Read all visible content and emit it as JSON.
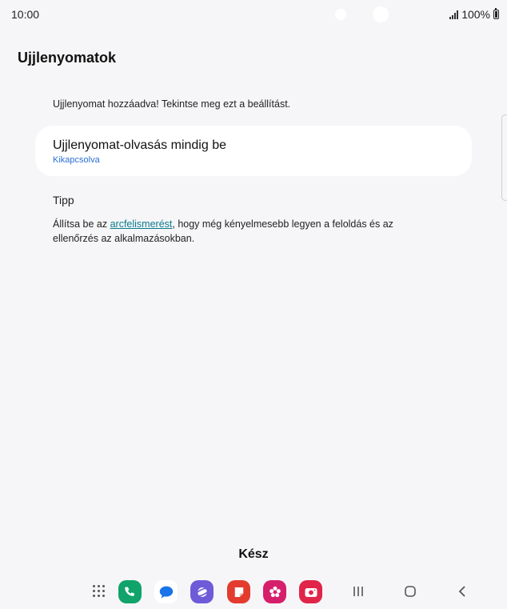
{
  "status_bar": {
    "time": "10:00",
    "battery": "100%"
  },
  "page": {
    "title": "Ujjlenyomatok",
    "added_message": "Ujjlenyomat hozzáadva! Tekintse meg ezt a beállítást."
  },
  "setting_card": {
    "title": "Ujjlenyomat-olvasás mindig be",
    "subtitle": "Kikapcsolva"
  },
  "tip": {
    "heading": "Tipp",
    "text_before": "Állítsa be az ",
    "link": "arcfelismerést",
    "text_after": ", hogy még kényelmesebb legyen a feloldás és az ellenőrzés az alkalmazásokban."
  },
  "done_label": "Kész",
  "colors": {
    "background": "#f6f6f8",
    "link": "#0b7a8c",
    "subtitle": "#2a6fd6"
  },
  "dock": {
    "icons": [
      "apps-grid-icon",
      "phone-icon",
      "messages-icon",
      "internet-icon",
      "notes-icon",
      "gallery-icon",
      "camera-icon"
    ]
  }
}
